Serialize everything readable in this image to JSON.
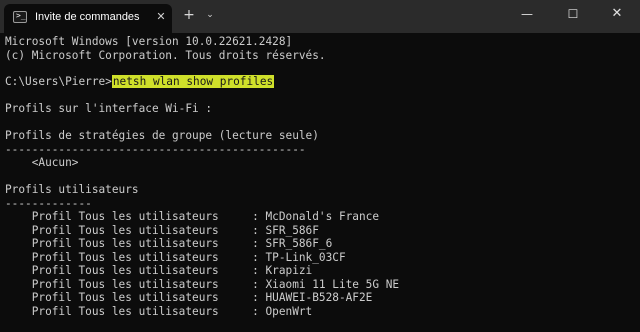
{
  "window": {
    "tab_title": "Invite de commandes",
    "tab_icon": "terminal-icon",
    "tab_icon_glyph": ">_",
    "close_tab_glyph": "✕",
    "new_tab_glyph": "+",
    "dropdown_glyph": "⌄",
    "minimize_glyph": "—",
    "maximize_glyph": "☐",
    "close_glyph": "✕"
  },
  "colors": {
    "background": "#0c0c0c",
    "text": "#cccccc",
    "titlebar": "#2b2b2b",
    "highlight": "#cfe02a"
  },
  "console": {
    "header_line1": "Microsoft Windows [version 10.0.22621.2428]",
    "header_line2": "(c) Microsoft Corporation. Tous droits réservés.",
    "prompt": "C:\\Users\\Pierre>",
    "command": "netsh wlan show profiles",
    "interface_line": "Profils sur l'interface Wi-Fi :",
    "group_policy_heading": "Profils de stratégies de groupe (lecture seule)",
    "group_policy_separator": "---------------------------------------------",
    "group_policy_none": "    <Aucun>",
    "user_profiles_heading": "Profils utilisateurs",
    "user_profiles_separator": "-------------",
    "profile_label": "    Profil Tous les utilisateurs     : ",
    "profiles": [
      "McDonald's France",
      "SFR_586F",
      "SFR_586F_6",
      "TP-Link_03CF",
      "Krapizi",
      "Xiaomi 11 Lite 5G NE",
      "HUAWEI-B528-AF2E",
      "OpenWrt"
    ]
  }
}
